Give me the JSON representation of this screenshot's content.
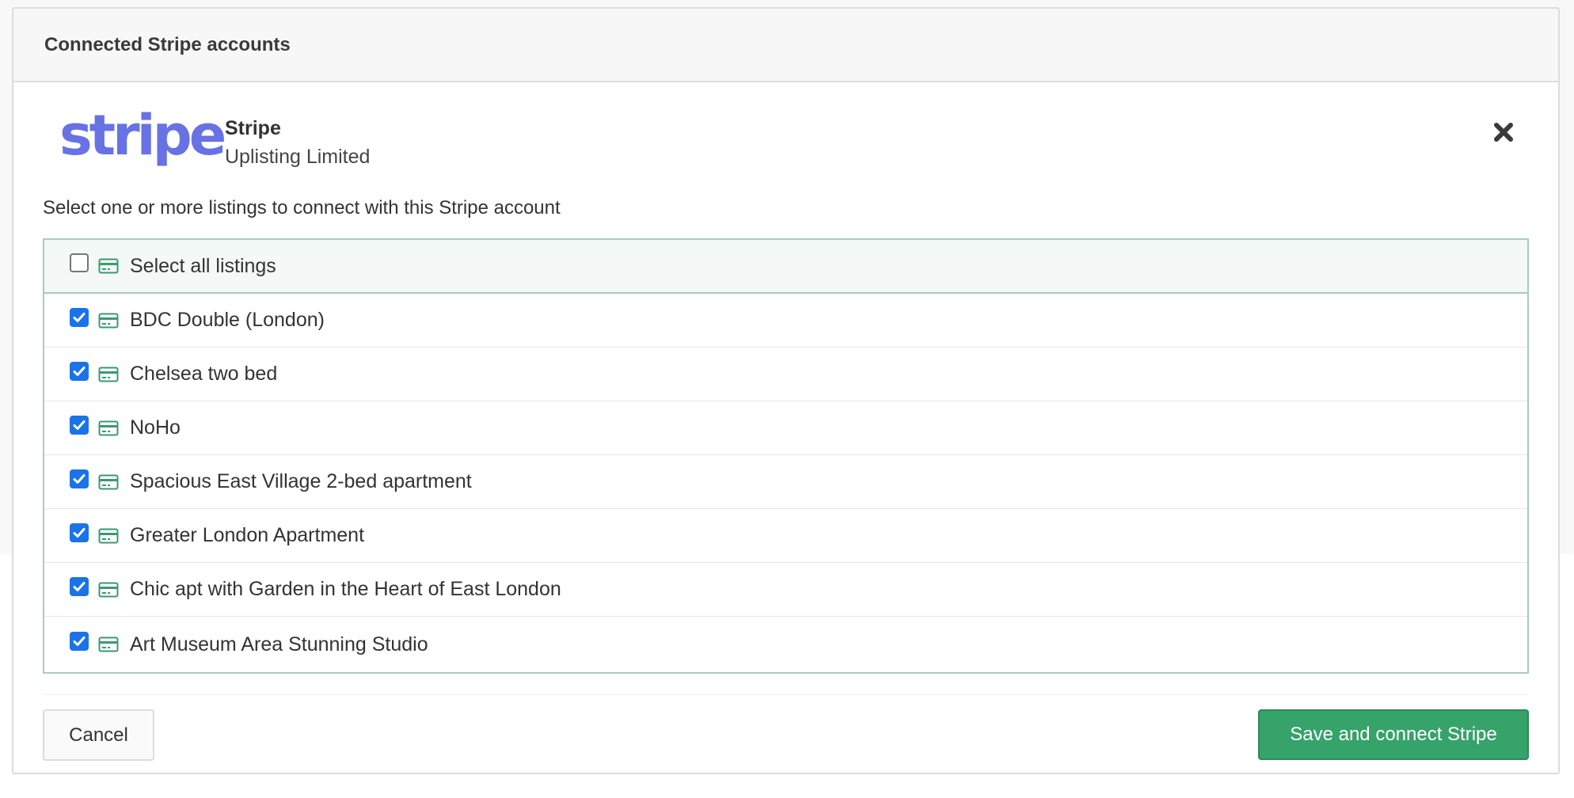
{
  "panel": {
    "title": "Connected Stripe accounts"
  },
  "account": {
    "logo_text": "stripe",
    "name": "Stripe",
    "subtitle": "Uplisting Limited",
    "brand_color": "#6772e5"
  },
  "instruction": "Select one or more listings to connect with this Stripe account",
  "select_all": {
    "label": "Select all listings",
    "checked": false
  },
  "listings": [
    {
      "label": "BDC Double (London)",
      "checked": true
    },
    {
      "label": "Chelsea two bed",
      "checked": true
    },
    {
      "label": "NoHo",
      "checked": true
    },
    {
      "label": "Spacious East Village 2-bed apartment",
      "checked": true
    },
    {
      "label": "Greater London Apartment",
      "checked": true
    },
    {
      "label": "Chic apt with Garden in the Heart of East London",
      "checked": true
    },
    {
      "label": "Art Museum Area Stunning Studio",
      "checked": true
    }
  ],
  "icons": {
    "close": "close-icon",
    "card": "credit-card-icon",
    "check": "checkmark-icon"
  },
  "colors": {
    "accent_green": "#36a36a",
    "checkbox_blue": "#1a73e8",
    "card_icon": "#3a9a70"
  },
  "footer": {
    "cancel_label": "Cancel",
    "save_label": "Save and connect Stripe"
  }
}
